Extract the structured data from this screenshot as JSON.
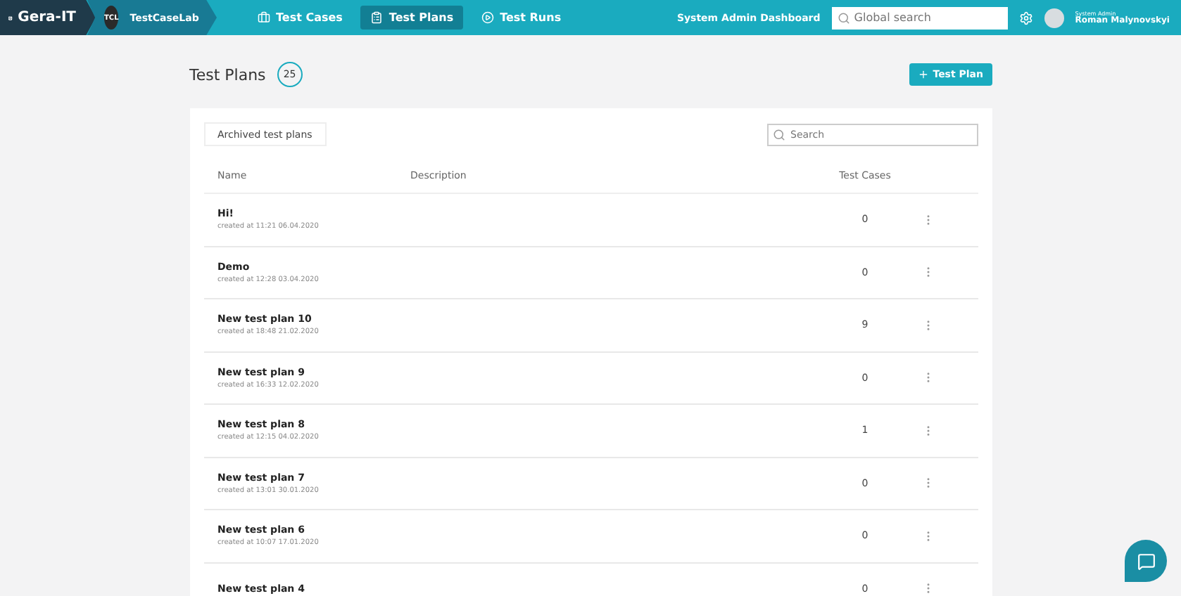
{
  "brand": {
    "name": "Gera-IT"
  },
  "project": {
    "badge": "TCL",
    "name": "TestCaseLab"
  },
  "nav": [
    {
      "label": "Test Cases",
      "selected": false
    },
    {
      "label": "Test Plans",
      "selected": true
    },
    {
      "label": "Test Runs",
      "selected": false
    }
  ],
  "admin_link": "System Admin Dashboard",
  "global_search": {
    "placeholder": "Global search"
  },
  "user": {
    "role": "System Admin",
    "name": "Roman Malynovskyi"
  },
  "page": {
    "title": "Test Plans",
    "count": "25",
    "add_button": "Test Plan"
  },
  "archived_button": "Archived test plans",
  "search": {
    "placeholder": "Search"
  },
  "table": {
    "columns": [
      "Name",
      "Description",
      "Test Cases"
    ],
    "rows": [
      {
        "name": "Hi!",
        "created": "created at 11:21 06.04.2020",
        "test_cases": "0"
      },
      {
        "name": "Demo",
        "created": "created at 12:28 03.04.2020",
        "test_cases": "0"
      },
      {
        "name": "New test plan 10",
        "created": "created at 18:48 21.02.2020",
        "test_cases": "9"
      },
      {
        "name": "New test plan 9",
        "created": "created at 16:33 12.02.2020",
        "test_cases": "0"
      },
      {
        "name": "New test plan 8",
        "created": "created at 12:15 04.02.2020",
        "test_cases": "1"
      },
      {
        "name": "New test plan 7",
        "created": "created at 13:01 30.01.2020",
        "test_cases": "0"
      },
      {
        "name": "New test plan 6",
        "created": "created at 10:07 17.01.2020",
        "test_cases": "0"
      },
      {
        "name": "New test plan 4",
        "test_cases": "0"
      }
    ]
  }
}
